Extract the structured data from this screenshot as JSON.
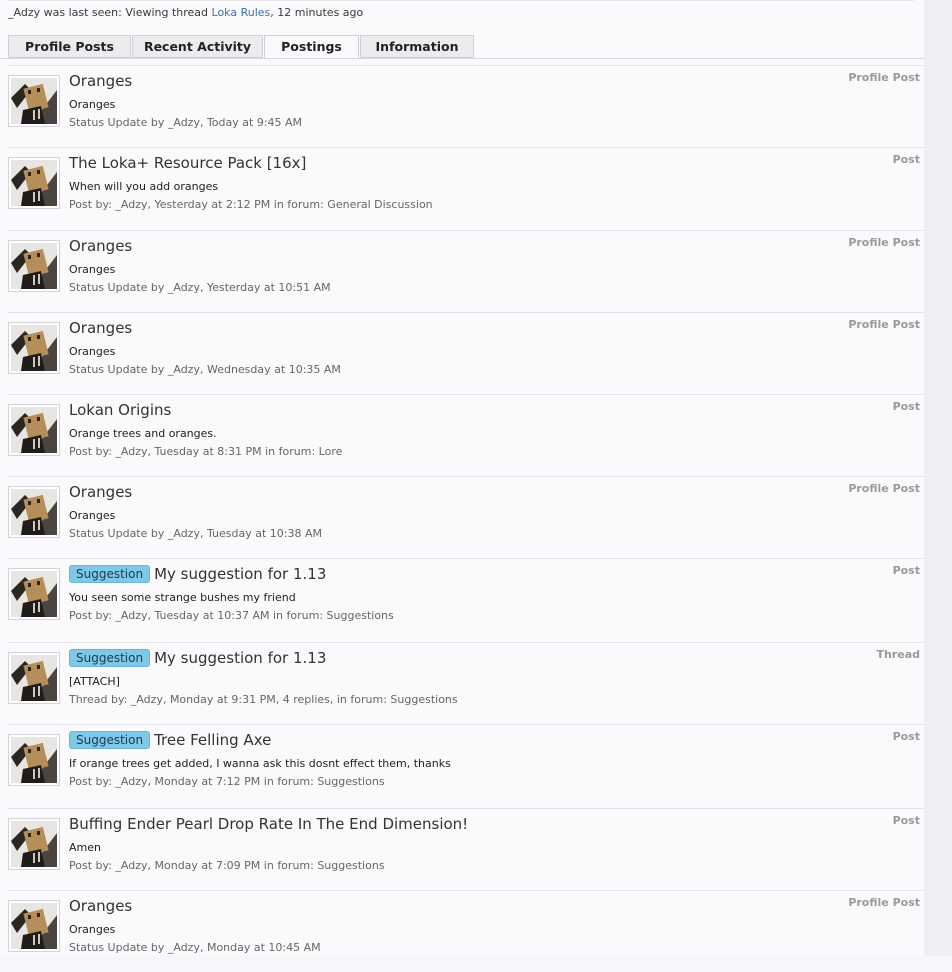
{
  "last_seen": {
    "user": "_Adzy",
    "text_before": " was last seen: Viewing thread ",
    "thread_link": "Loka Rules",
    "text_after": ", 12 minutes ago"
  },
  "tabs": [
    {
      "label": "Profile Posts",
      "active": false
    },
    {
      "label": "Recent Activity",
      "active": false
    },
    {
      "label": "Postings",
      "active": true
    },
    {
      "label": "Information",
      "active": false
    }
  ],
  "postings": [
    {
      "title": "Oranges",
      "badge": "",
      "type": "Profile Post",
      "snippet": "Oranges",
      "meta": "Status Update by _Adzy, Today at 9:45 AM"
    },
    {
      "title": "The Loka+ Resource Pack [16x]",
      "badge": "",
      "type": "Post",
      "snippet": "When will you add oranges",
      "meta": "Post by: _Adzy, Yesterday at 2:12 PM in forum: General Discussion"
    },
    {
      "title": "Oranges",
      "badge": "",
      "type": "Profile Post",
      "snippet": "Oranges",
      "meta": "Status Update by _Adzy, Yesterday at 10:51 AM"
    },
    {
      "title": "Oranges",
      "badge": "",
      "type": "Profile Post",
      "snippet": "Oranges",
      "meta": "Status Update by _Adzy, Wednesday at 10:35 AM"
    },
    {
      "title": "Lokan Origins",
      "badge": "",
      "type": "Post",
      "snippet": "Orange trees and oranges.",
      "meta": "Post by: _Adzy, Tuesday at 8:31 PM in forum: Lore"
    },
    {
      "title": "Oranges",
      "badge": "",
      "type": "Profile Post",
      "snippet": "Oranges",
      "meta": "Status Update by _Adzy, Tuesday at 10:38 AM"
    },
    {
      "title": "My suggestion for 1.13",
      "badge": "Suggestion",
      "type": "Post",
      "snippet": "You seen some strange bushes my friend",
      "meta": "Post by: _Adzy, Tuesday at 10:37 AM in forum: Suggestions"
    },
    {
      "title": "My suggestion for 1.13",
      "badge": "Suggestion",
      "type": "Thread",
      "snippet": "[ATTACH]",
      "meta": "Thread by: _Adzy, Monday at 9:31 PM, 4 replies, in forum: Suggestions"
    },
    {
      "title": "Tree Felling Axe",
      "badge": "Suggestion",
      "type": "Post",
      "snippet": "If orange trees get added, I wanna ask this dosnt effect them, thanks",
      "meta": "Post by: _Adzy, Monday at 7:12 PM in forum: Suggestions"
    },
    {
      "title": "Buffing Ender Pearl Drop Rate In The End Dimension!",
      "badge": "",
      "type": "Post",
      "snippet": "Amen",
      "meta": "Post by: _Adzy, Monday at 7:09 PM in forum: Suggestions"
    },
    {
      "title": "Oranges",
      "badge": "",
      "type": "Profile Post",
      "snippet": "Oranges",
      "meta": "Status Update by _Adzy, Monday at 10:45 AM"
    }
  ]
}
